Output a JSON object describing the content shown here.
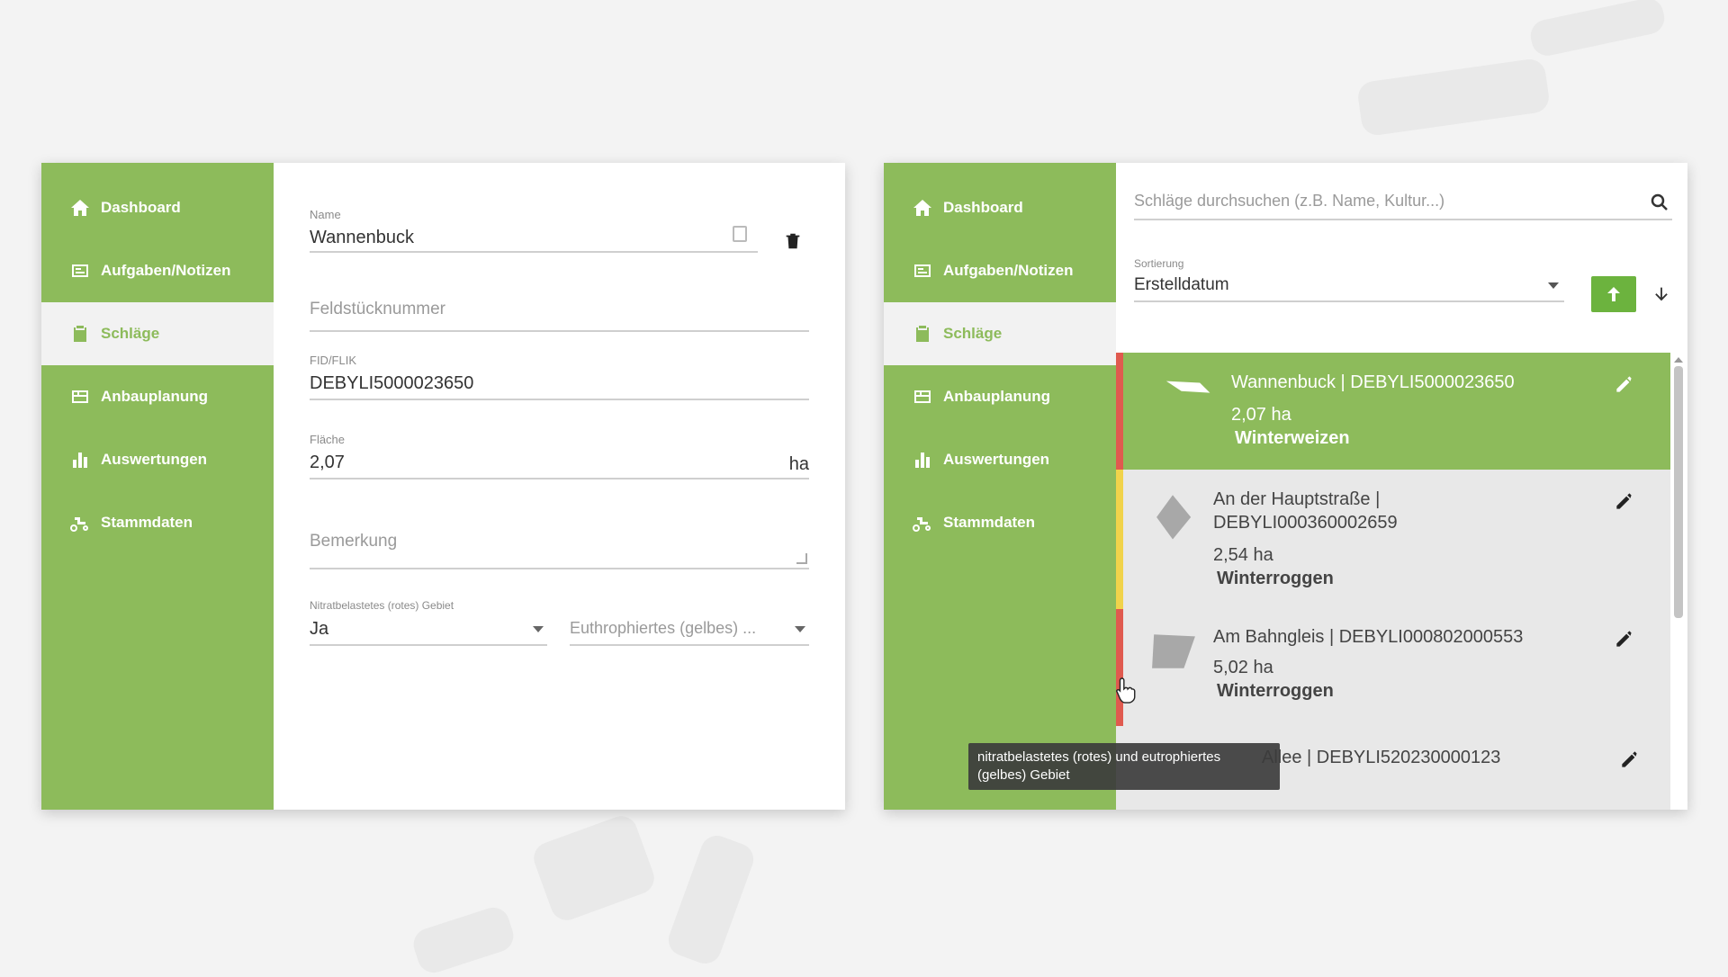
{
  "nav": [
    {
      "label": "Dashboard",
      "icon": "home-icon"
    },
    {
      "label": "Aufgaben/Notizen",
      "icon": "tasks-icon"
    },
    {
      "label": "Schläge",
      "icon": "clipboard-icon"
    },
    {
      "label": "Anbauplanung",
      "icon": "planning-icon"
    },
    {
      "label": "Auswertungen",
      "icon": "bar-chart-icon"
    },
    {
      "label": "Stammdaten",
      "icon": "tractor-icon"
    }
  ],
  "active_nav": "Schläge",
  "form": {
    "name_label": "Name",
    "name_value": "Wannenbuck",
    "feldstueck_placeholder": "Feldstücknummer",
    "fid_label": "FID/FLIK",
    "fid_value": "DEBYLI5000023650",
    "flaeche_label": "Fläche",
    "flaeche_value": "2,07",
    "flaeche_unit": "ha",
    "bemerkung_placeholder": "Bemerkung",
    "nitrat_label": "Nitratbelastetes (rotes) Gebiet",
    "nitrat_value": "Ja",
    "euthro_placeholder": "Euthrophiertes (gelbes) ..."
  },
  "right": {
    "search_placeholder": "Schläge durchsuchen (z.B. Name, Kultur...)",
    "sort_label": "Sortierung",
    "sort_value": "Erstelldatum",
    "items": [
      {
        "name": "Wannenbuck | DEBYLI5000023650",
        "area": "2,07 ha",
        "crop": "Winterweizen",
        "selected": true,
        "marker": "#e05a4f"
      },
      {
        "name": "An der Hauptstraße |",
        "name2": "DEBYLI000360002659",
        "area": "2,54 ha",
        "crop": "Winterroggen",
        "selected": false,
        "marker": "#f1d34b"
      },
      {
        "name": "Am Bahngleis | DEBYLI000802000553",
        "area": "5,02 ha",
        "crop": "Winterroggen",
        "selected": false,
        "marker": "#e05a4f"
      },
      {
        "name": "Allee | DEBYLI520230000123",
        "selected": false
      }
    ],
    "tooltip": "nitratbelastetes (rotes) und eutrophiertes (gelbes) Gebiet"
  },
  "colors": {
    "accent": "#8dbb5b",
    "red": "#e05a4f",
    "yellow": "#f1d34b"
  }
}
